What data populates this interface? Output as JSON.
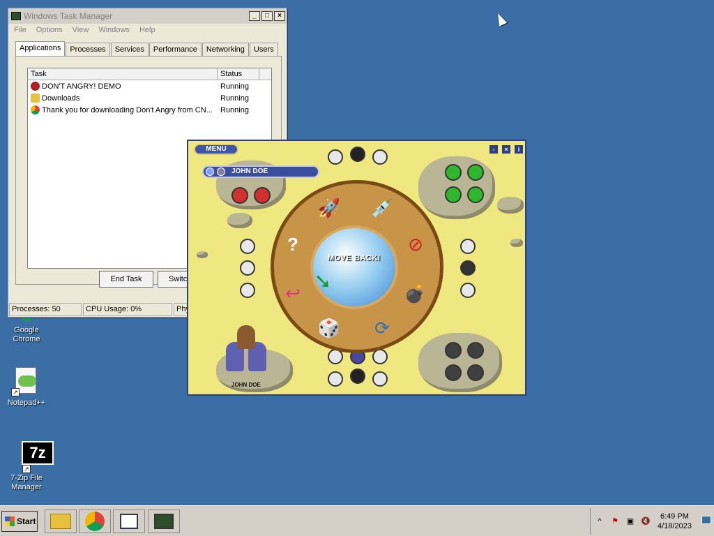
{
  "desktop": {
    "icons": [
      {
        "label": "Google Chrome",
        "icon": "chrome-icon"
      },
      {
        "label": "Notepad++",
        "icon": "notepadpp-icon"
      },
      {
        "label": "7-Zip File Manager",
        "icon": "7zip-icon",
        "badge": "7z"
      }
    ]
  },
  "taskmgr": {
    "title": "Windows Task Manager",
    "menu": [
      "File",
      "Options",
      "View",
      "Windows",
      "Help"
    ],
    "tabs": [
      "Applications",
      "Processes",
      "Services",
      "Performance",
      "Networking",
      "Users"
    ],
    "columns": {
      "task": "Task",
      "status": "Status"
    },
    "rows": [
      {
        "task": "DON'T ANGRY! DEMO",
        "status": "Running",
        "icon": "game-icon"
      },
      {
        "task": "Downloads",
        "status": "Running",
        "icon": "folder-icon"
      },
      {
        "task": "Thank you for downloading Don't Angry from CN...",
        "status": "Running",
        "icon": "chrome-icon"
      }
    ],
    "end_task": "End Task",
    "switch_to": "Switch",
    "status": {
      "processes": "Processes: 50",
      "cpu": "CPU Usage: 0%",
      "phys": "Phy"
    }
  },
  "game": {
    "menu_label": "MENU",
    "player_name": "JOHN DOE",
    "center_text": "MOVE BACK!",
    "char_label": "JOHN DOE",
    "controls": [
      "restore",
      "close",
      "info"
    ],
    "colors": {
      "red": "#d03030",
      "green": "#2eb82e",
      "black": "#404040",
      "blue": "#4848a0"
    }
  },
  "taskbar": {
    "start_label": "Start",
    "apps": [
      "explorer-icon",
      "chrome-icon",
      "document-icon",
      "taskmgr-icon"
    ],
    "clock_time": "6:49 PM",
    "clock_date": "4/18/2023",
    "tray_arrow": "^"
  }
}
